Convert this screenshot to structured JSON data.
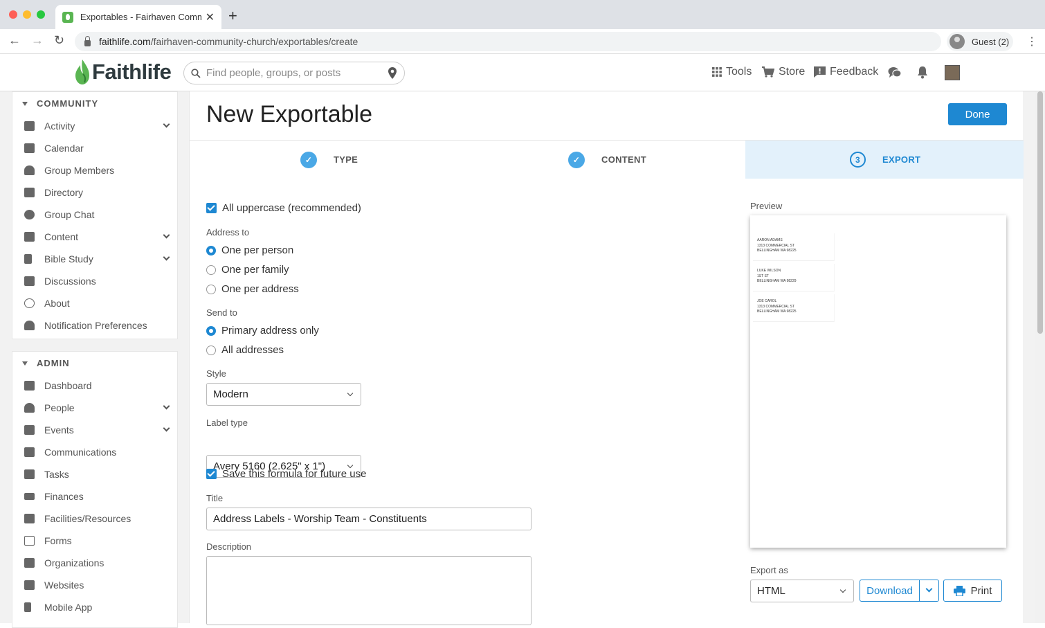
{
  "browser": {
    "tab_title": "Exportables - Fairhaven Comm",
    "url_host": "faithlife.com",
    "url_path": "/fairhaven-community-church/exportables/create",
    "profile_label": "Guest (2)"
  },
  "header": {
    "logo_text": "Faithlife",
    "search_placeholder": "Find people, groups, or posts",
    "tools_label": "Tools",
    "store_label": "Store",
    "feedback_label": "Feedback"
  },
  "sidebar": {
    "community_heading": "COMMUNITY",
    "community_items": [
      {
        "label": "Activity"
      },
      {
        "label": "Calendar"
      },
      {
        "label": "Group Members"
      },
      {
        "label": "Directory"
      },
      {
        "label": "Group Chat"
      },
      {
        "label": "Content"
      },
      {
        "label": "Bible Study"
      },
      {
        "label": "Discussions"
      },
      {
        "label": "About"
      },
      {
        "label": "Notification Preferences"
      }
    ],
    "admin_heading": "ADMIN",
    "admin_items": [
      {
        "label": "Dashboard"
      },
      {
        "label": "People"
      },
      {
        "label": "Events"
      },
      {
        "label": "Communications"
      },
      {
        "label": "Tasks"
      },
      {
        "label": "Finances"
      },
      {
        "label": "Facilities/Resources"
      },
      {
        "label": "Forms"
      },
      {
        "label": "Organizations"
      },
      {
        "label": "Websites"
      },
      {
        "label": "Mobile App"
      }
    ]
  },
  "main": {
    "title": "New Exportable",
    "done_label": "Done",
    "steps": [
      {
        "number": "",
        "label": "TYPE"
      },
      {
        "number": "",
        "label": "CONTENT"
      },
      {
        "number": "3",
        "label": "EXPORT"
      }
    ],
    "uppercase_label": "All uppercase (recommended)",
    "address_to_label": "Address to",
    "address_to_options": [
      "One per person",
      "One per family",
      "One per address"
    ],
    "send_to_label": "Send to",
    "send_to_options": [
      "Primary address only",
      "All addresses"
    ],
    "style_label": "Style",
    "style_value": "Modern",
    "label_type_label": "Label type",
    "label_type_value": "Avery 5160 (2.625\" x 1\")",
    "save_formula_label": "Save this formula for future use",
    "title_label": "Title",
    "title_value": "Address Labels - Worship Team - Constituents",
    "description_label": "Description",
    "preview_label": "Preview",
    "preview_labels": [
      {
        "name": "AARON ADAMS",
        "street": "1313 COMMERCIAL ST",
        "city": "BELLINGHAM WA 98225"
      },
      {
        "name": "LUKE WILSON",
        "street": "1ST ST",
        "city": "BELLINGHAM WA 98229"
      },
      {
        "name": "JOE CAROL",
        "street": "1313 COMMERCIAL ST",
        "city": "BELLINGHAM WA 98225"
      }
    ],
    "export_as_label": "Export as",
    "export_as_value": "HTML",
    "download_label": "Download",
    "print_label": "Print"
  },
  "colors": {
    "accent": "#1e88d2",
    "brand_green": "#5ab552"
  }
}
